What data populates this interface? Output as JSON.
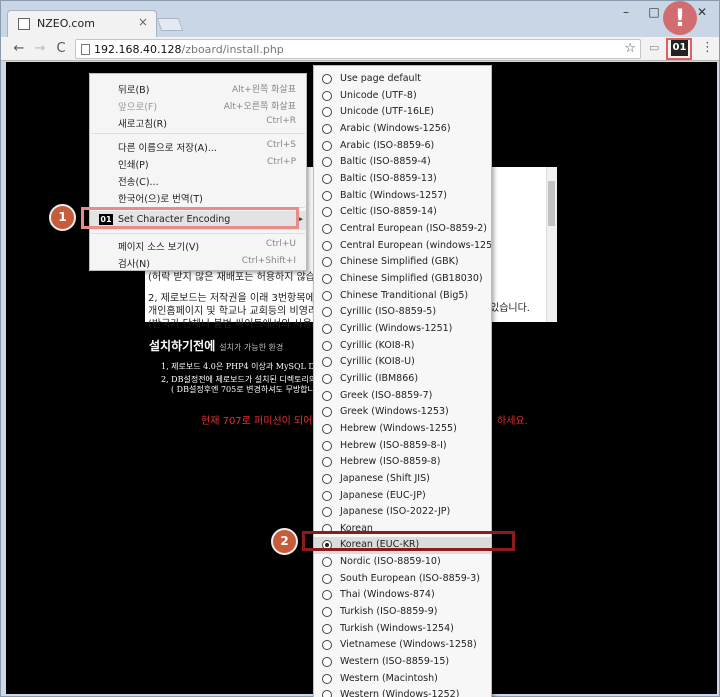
{
  "tab": {
    "title": "NZEO.com",
    "close": "×"
  },
  "window_controls": {
    "minimize": "–",
    "maximize": "□",
    "close": "✕"
  },
  "toolbar": {
    "back": "←",
    "forward": "→",
    "reload": "C",
    "url_host": "192.168.40.128",
    "url_path": "/zboard/install.php",
    "star": "☆",
    "extension_badge": "01",
    "menu": "⋮",
    "alert_icon": "!"
  },
  "context_menu": {
    "items": [
      {
        "label": "뒤로(B)",
        "shortcut": "Alt+왼쪽 화살표",
        "disabled": false
      },
      {
        "label": "앞으로(F)",
        "shortcut": "Alt+오른쪽 화살표",
        "disabled": true
      },
      {
        "label": "새로고침(R)",
        "shortcut": "Ctrl+R",
        "disabled": false
      },
      {
        "label": "다른 이름으로 저장(A)...",
        "shortcut": "Ctrl+S",
        "disabled": false
      },
      {
        "label": "인쇄(P)",
        "shortcut": "Ctrl+P",
        "disabled": false
      },
      {
        "label": "전송(C)...",
        "shortcut": "",
        "disabled": false
      },
      {
        "label": "한국어(으)로 번역(T)",
        "shortcut": "",
        "disabled": false
      },
      {
        "label": "Set Character Encoding",
        "shortcut": "",
        "disabled": false
      },
      {
        "label": "페이지 소스 보기(V)",
        "shortcut": "Ctrl+U",
        "disabled": false
      },
      {
        "label": "검사(N)",
        "shortcut": "Ctrl+Shift+I",
        "disabled": false
      }
    ]
  },
  "encoding_menu": {
    "items": [
      "Use page default",
      "Unicode (UTF-8)",
      "Unicode (UTF-16LE)",
      "Arabic (Windows-1256)",
      "Arabic (ISO-8859-6)",
      "Baltic (ISO-8859-4)",
      "Baltic (ISO-8859-13)",
      "Baltic (Windows-1257)",
      "Celtic (ISO-8859-14)",
      "Central European (ISO-8859-2)",
      "Central European (windows-1250)",
      "Chinese Simplified (GBK)",
      "Chinese Simplified (GB18030)",
      "Chinese Tranditional (Big5)",
      "Cyrillic (ISO-8859-5)",
      "Cyrillic (Windows-1251)",
      "Cyrillic (KOI8-R)",
      "Cyrillic (KOI8-U)",
      "Cyrillic (IBM866)",
      "Greek (ISO-8859-7)",
      "Greek (Windows-1253)",
      "Hebrew (Windows-1255)",
      "Hebrew (ISO-8859-8-I)",
      "Hebrew (ISO-8859-8)",
      "Japanese (Shift JIS)",
      "Japanese (EUC-JP)",
      "Japanese (ISO-2022-JP)",
      "Korean",
      "Korean (EUC-KR)",
      "Nordic (ISO-8859-10)",
      "South European (ISO-8859-3)",
      "Thai (Windows-874)",
      "Turkish (ISO-8859-9)",
      "Turkish (Windows-1254)",
      "Vietnamese (Windows-1258)",
      "Western (ISO-8859-15)",
      "Western (Macintosh)",
      "Western (Windows-1252)"
    ],
    "selected_index": 28
  },
  "page": {
    "license_lines": [
      "(허락 받지 않은 재배포는 허용하지 않습",
      "2, 제로보드는 저작권을 이래 3번항목에 의",
      "개인홈페이지 및 학교나 교회등의 비영리",
      "(반국가 단체나 불법 싸이트에서의 사용은"
    ],
    "license_overflow": "있습니다.",
    "section_title": "설치하기전에",
    "section_sub": "설치가 가능한 환경",
    "requirements": [
      "1, 제로보드 4.0은 PHP4 이상과 MySQL DB Se",
      "2, DB설정전에 제로보드가 설치된 디렉토리의",
      "( DB설정후엔 705로 변경하셔도 무방합니다, , 자료"
    ],
    "warning_left": "현재 707로 퍼미션이 되어 있",
    "warning_right": "하세요."
  },
  "steps": {
    "one": "1",
    "two": "2"
  }
}
